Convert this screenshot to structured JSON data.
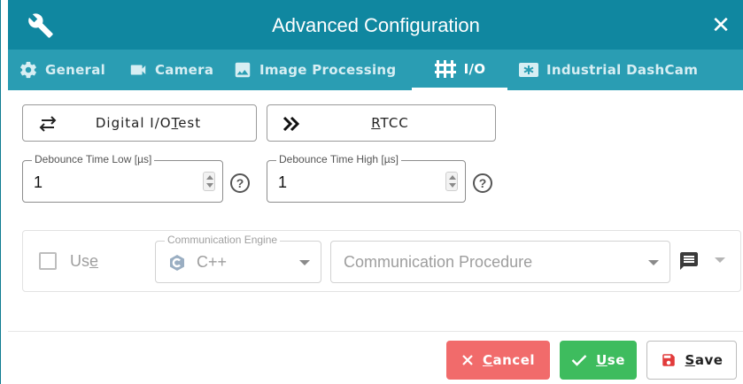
{
  "window": {
    "title": "Advanced Configuration",
    "close_glyph": "✕",
    "icon": "wrench-icon"
  },
  "tabs": [
    {
      "label": "General",
      "icon": "gear-icon",
      "active": false
    },
    {
      "label": "Camera",
      "icon": "video-camera-icon",
      "active": false
    },
    {
      "label": "Image Processing",
      "icon": "image-icon",
      "active": false
    },
    {
      "label": "I/O",
      "icon": "io-icon",
      "active": true
    },
    {
      "label": "Industrial DashCam",
      "icon": "dashcam-icon",
      "active": false
    }
  ],
  "io": {
    "digital_test": {
      "pre": "Digital I/O",
      "ul": "T",
      "post": "est",
      "icon": "swap-arrows-icon"
    },
    "rtcc": {
      "ul": "R",
      "post": "TCC",
      "icon": "double-chevron-right-icon"
    },
    "debounce_low": {
      "label": "Debounce Time Low [µs]",
      "value": "1"
    },
    "debounce_high": {
      "label": "Debounce Time High [µs]",
      "value": "1"
    },
    "help_glyph": "?"
  },
  "communication": {
    "use_pre": "Us",
    "use_ul": "e",
    "engine_label": "Communication Engine",
    "engine_value": "C++",
    "procedure_placeholder": "Communication Procedure",
    "comment_icon": "comment-icon"
  },
  "footer": {
    "cancel": {
      "ul": "C",
      "post": "ancel"
    },
    "use": {
      "ul": "U",
      "post": "se"
    },
    "save": {
      "ul": "S",
      "post": "ave"
    }
  },
  "colors": {
    "titlebar": "#1087a0",
    "tabbar": "#2a9db3",
    "cancel": "#f16b6b",
    "use": "#3ebc5e"
  }
}
